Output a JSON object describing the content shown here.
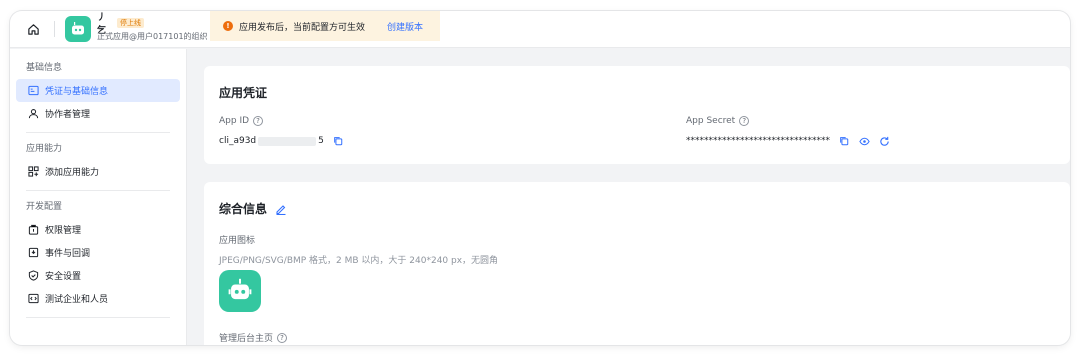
{
  "topbar": {
    "home_icon": "home-icon",
    "app_name": "丿 乞",
    "status_badge": "停上线",
    "app_org": "正式应用@用户017101的组织"
  },
  "notice": {
    "icon": "alert-icon",
    "text": "应用发布后，当前配置方可生效",
    "link": "创建版本"
  },
  "sidebar": {
    "groups": [
      {
        "title": "基础信息",
        "items": [
          {
            "label": "凭证与基础信息",
            "icon": "credential-icon",
            "active": true
          },
          {
            "label": "协作者管理",
            "icon": "user-icon",
            "active": false
          }
        ]
      },
      {
        "title": "应用能力",
        "items": [
          {
            "label": "添加应用能力",
            "icon": "apps-icon",
            "active": false
          }
        ]
      },
      {
        "title": "开发配置",
        "items": [
          {
            "label": "权限管理",
            "icon": "permission-icon",
            "active": false
          },
          {
            "label": "事件与回调",
            "icon": "event-icon",
            "active": false
          },
          {
            "label": "安全设置",
            "icon": "shield-icon",
            "active": false
          },
          {
            "label": "测试企业和人员",
            "icon": "test-icon",
            "active": false
          }
        ]
      }
    ]
  },
  "credentials": {
    "title": "应用凭证",
    "app_id_label": "App ID",
    "app_id_prefix": "cli_a93d",
    "app_id_suffix": "5",
    "app_secret_label": "App Secret",
    "app_secret_value": "********************************"
  },
  "info": {
    "title": "综合信息",
    "icon_label": "应用图标",
    "icon_hint": "JPEG/PNG/SVG/BMP 格式，2 MB 以内，大于 240*240 px，无圆角",
    "admin_home_label": "管理后台主页"
  },
  "colors": {
    "accent": "#3370ff",
    "logo": "#34c7a0",
    "notice_bg": "#fdf3e0",
    "warning": "#ed6d0c"
  }
}
